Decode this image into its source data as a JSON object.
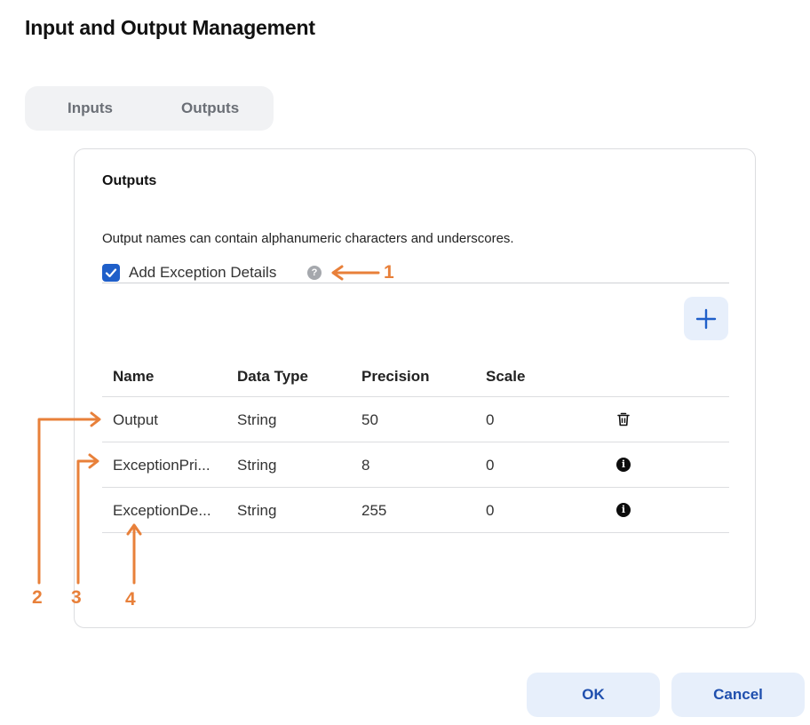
{
  "dialog": {
    "title": "Input and Output Management"
  },
  "tabs": [
    {
      "label": "Inputs"
    },
    {
      "label": "Outputs"
    }
  ],
  "panel": {
    "title": "Outputs",
    "description": "Output names can contain alphanumeric characters and underscores.",
    "exception_checkbox": {
      "label": "Add Exception Details",
      "checked": true,
      "help_icon": "?"
    }
  },
  "table": {
    "headers": [
      "Name",
      "Data Type",
      "Precision",
      "Scale"
    ],
    "rows": [
      {
        "name": "Output",
        "data_type": "String",
        "precision": "50",
        "scale": "0",
        "action_icon": "trash-icon"
      },
      {
        "name": "ExceptionPri...",
        "data_type": "String",
        "precision": "8",
        "scale": "0",
        "action_icon": "info-icon"
      },
      {
        "name": "ExceptionDe...",
        "data_type": "String",
        "precision": "255",
        "scale": "0",
        "action_icon": "info-icon"
      }
    ]
  },
  "buttons": {
    "ok_label": "OK",
    "cancel_label": "Cancel"
  },
  "callouts": [
    "1",
    "2",
    "3",
    "4"
  ],
  "colors": {
    "accent": "#1f5fc9",
    "button_bg": "#e7effb",
    "annotation": "#e8803a"
  }
}
